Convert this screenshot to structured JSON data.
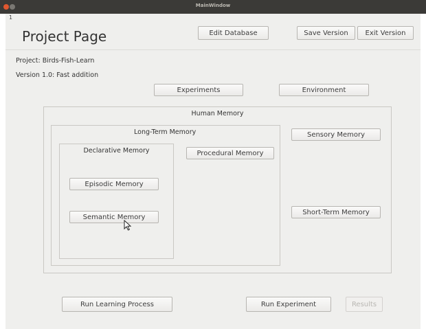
{
  "window": {
    "title": "MainWindow",
    "menu_marker": "1"
  },
  "header": {
    "page_title": "Project Page",
    "edit_database": "Edit Database",
    "save_version": "Save Version",
    "exit_version": "Exit Version"
  },
  "project": {
    "name_line": "Project: Birds-Fish-Learn",
    "version_line": "Version 1.0: Fast addition"
  },
  "tabs": {
    "experiments": "Experiments",
    "environment": "Environment"
  },
  "memory": {
    "human_memory": "Human Memory",
    "long_term": "Long-Term Memory",
    "declarative": "Declarative Memory",
    "episodic": "Episodic Memory",
    "semantic": "Semantic Memory",
    "procedural": "Procedural Memory",
    "sensory": "Sensory Memory",
    "short_term": "Short-Term Memory"
  },
  "footer": {
    "run_learning": "Run Learning Process",
    "run_experiment": "Run Experiment",
    "results": "Results"
  },
  "icons": {
    "cursor": "mouse-pointer-icon"
  },
  "colors": {
    "titlebar": "#3b3a37",
    "close_button": "#e0572f",
    "window_bg": "#efefed"
  }
}
